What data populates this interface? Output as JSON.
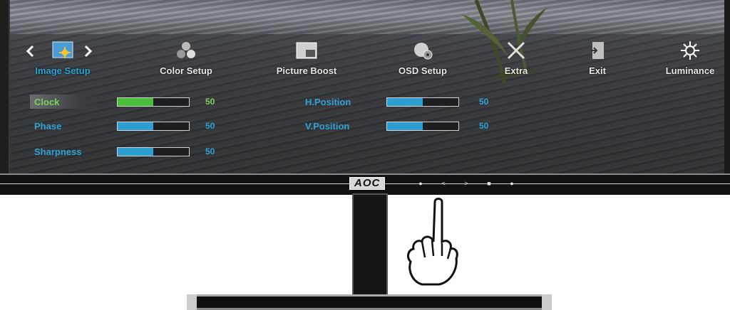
{
  "menu": {
    "items": [
      {
        "label": "Image Setup",
        "icon": "image-setup-icon"
      },
      {
        "label": "Color Setup",
        "icon": "color-setup-icon"
      },
      {
        "label": "Picture Boost",
        "icon": "picture-boost-icon"
      },
      {
        "label": "OSD Setup",
        "icon": "osd-setup-icon"
      },
      {
        "label": "Extra",
        "icon": "extra-icon"
      },
      {
        "label": "Exit",
        "icon": "exit-icon"
      },
      {
        "label": "Luminance",
        "icon": "luminance-icon"
      }
    ],
    "active_index": 0
  },
  "settings": [
    {
      "name": "Clock",
      "value": "50",
      "level": 0.5,
      "selected": true
    },
    {
      "name": "Phase",
      "value": "50",
      "level": 0.5,
      "selected": false
    },
    {
      "name": "Sharpness",
      "value": "50",
      "level": 0.5,
      "selected": false
    },
    {
      "name": "H.Position",
      "value": "50",
      "level": 0.5,
      "selected": false
    },
    {
      "name": "V.Position",
      "value": "50",
      "level": 0.5,
      "selected": false
    }
  ],
  "bezel": {
    "logo": "AOC",
    "buttons": [
      {
        "glyph": "●",
        "icon": "power-dot-icon"
      },
      {
        "glyph": "<",
        "icon": "left-arrow-icon"
      },
      {
        "glyph": ">",
        "icon": "right-arrow-icon"
      },
      {
        "glyph": "■",
        "icon": "menu-square-icon"
      },
      {
        "glyph": "●",
        "icon": "auto-dot-icon"
      }
    ]
  },
  "colors": {
    "accent_blue": "#2ea3d4",
    "selected_green": "#7cd35a",
    "bar_fill_selected": "#4bbd3c"
  }
}
